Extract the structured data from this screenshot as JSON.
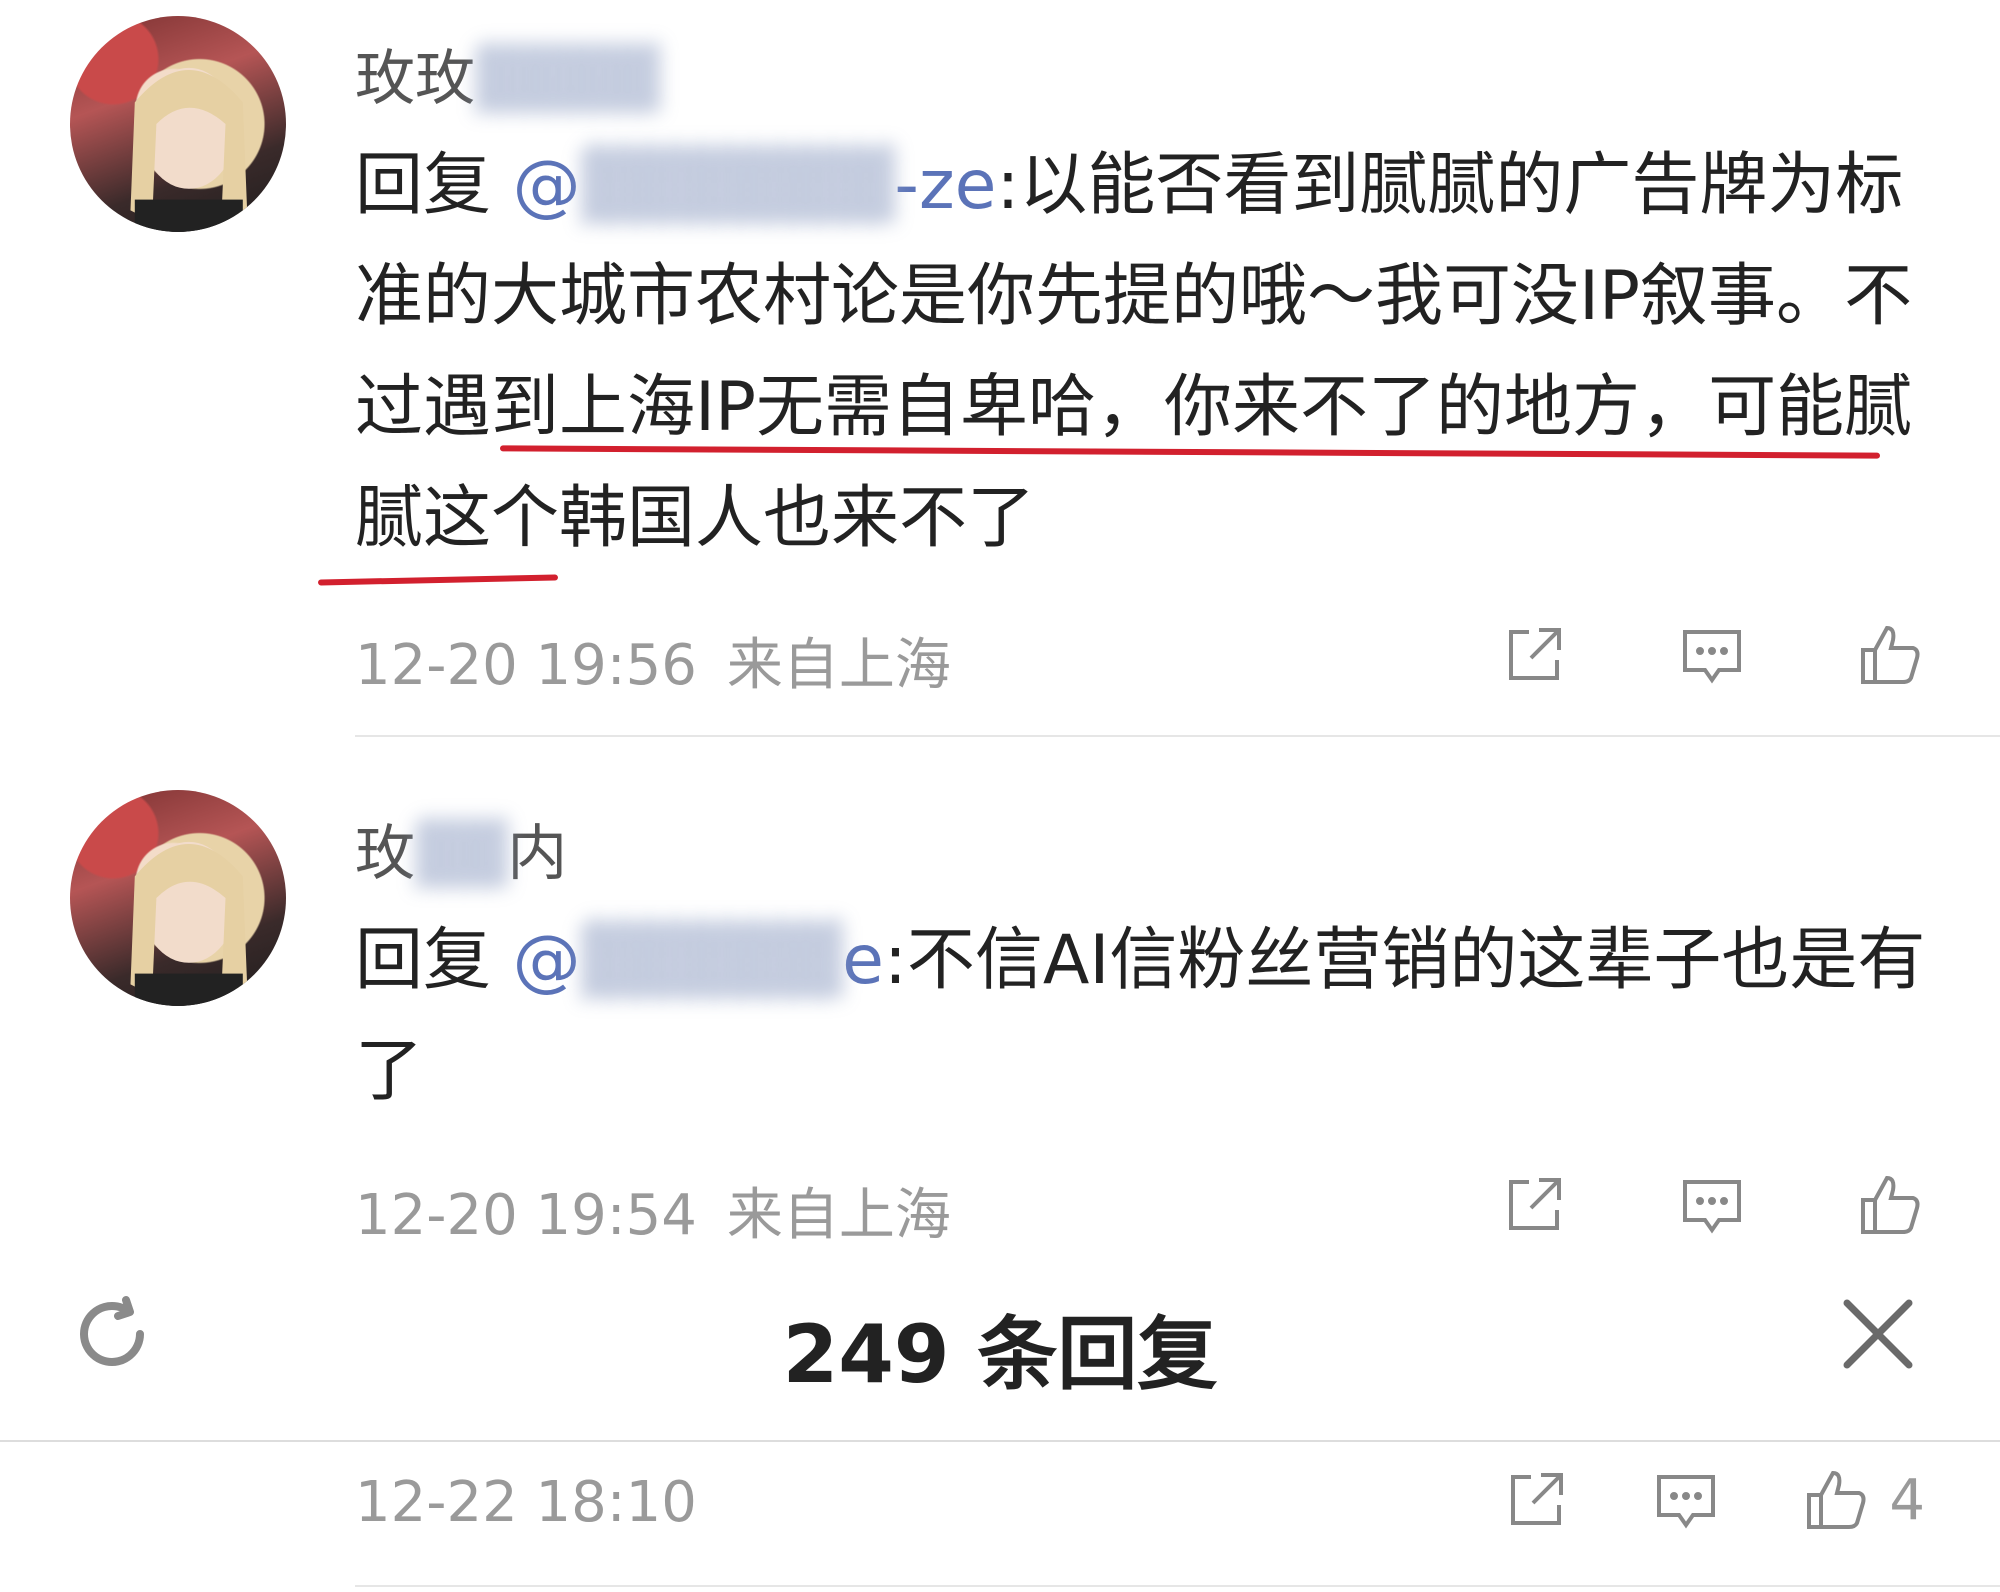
{
  "comments": [
    {
      "username_visible": "玫玫",
      "reply_prefix": "回复 ",
      "mention_visible": "@",
      "mention_suffix": "-ze",
      "text_part1": ":以能否看到腻腻的广告牌为标准的大城市农村论是你先提的哦～我可没IP叙事。",
      "text_highlight": "不过遇到上海IP无需自卑哈，你来不了的地方，",
      "text_part2": "可能腻腻这个韩国人也来不了",
      "time": "12-20 19:56",
      "location": "来自上海"
    },
    {
      "username_visible_a": "玫",
      "username_visible_b": "内",
      "reply_prefix": "回复 ",
      "mention_visible": "@",
      "mention_suffix": "e",
      "text_part1": ":不信AI信粉丝营销的这辈子也是有了",
      "time": "12-20 19:54",
      "location": "来自上海"
    }
  ],
  "reply_bar": {
    "title": "249 条回复"
  },
  "bottom_post": {
    "time": "12-22 18:10",
    "like_count": "4"
  },
  "icons": [
    "share-icon",
    "comment-icon",
    "like-icon",
    "refresh-icon",
    "close-icon"
  ],
  "colors": {
    "mention": "#5b73b8",
    "highlight_underline": "#d2202e",
    "meta_text": "#9a9a9a"
  }
}
